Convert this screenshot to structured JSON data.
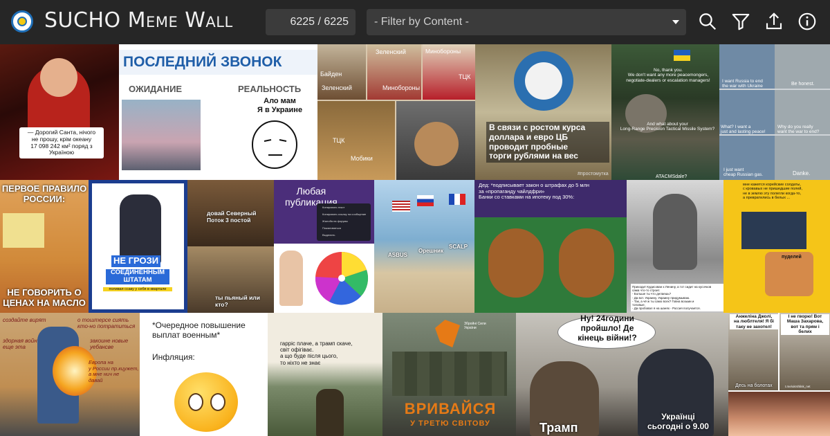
{
  "app": {
    "title_first": "SUCHO",
    "title_rest": "Meme Wall",
    "counter": "6225 / 6225",
    "filter_placeholder": "- Filter by Content -"
  },
  "toolbar": {
    "icons": [
      "search-icon",
      "filter-icon",
      "upload-icon",
      "info-icon"
    ]
  },
  "memes": {
    "santa": "— Дорогий Санта, нічого\nне прошу, крім океану\n17 098 242 км² поряд з\nУкраїною",
    "zvonok_title": "ПОСЛЕДНИЙ ЗВОНОК",
    "zvonok_left": "ОЖИДАНИЕ",
    "zvonok_right": "РЕАЛЬНОСТЬ",
    "zvonok_quote": "Ало мам\nЯ в Украине",
    "p1_a": "Байден",
    "p1_b": "Зеленский",
    "p1_c": "Минобороны",
    "p1_d": "Зеленский",
    "p1_e": "Минобороны",
    "p1_f": "ТЦК",
    "p1_g": "ТЦК",
    "p1_h": "Мобики",
    "scale": "В связи с ростом курса\nдоллара и евро ЦБ\nпроводит пробные\nторги рублями на вес",
    "scale_tag": "#простомутка",
    "gandalf_1": "No, thank you.\nWe don't want any more peacemongers,\nnegotiate-dealers or escalation managers!",
    "gandalf_2": "And what about your\nLong-Range Precision Tactical Missile System?",
    "gandalf_3": "ATACMSdale?",
    "scholz_1": "I want Russia to end\nthe war with Ukraine",
    "scholz_2": "Be honest.",
    "scholz_3": "What? I want a\njust and lasting peace!",
    "scholz_4": "Why do you really\nwant the war to end?",
    "scholz_5": "I just want\ncheap Russian gas.",
    "scholz_6": "Danke.",
    "fightclub_top": "ПЕРВОЕ ПРАВИЛО\nРОССИИ:",
    "fightclub_bottom": "НЕ ГОВОРИТЬ О\nЦЕНАХ НА МАСЛО",
    "medvedev_1": "НЕ ГРОЗИ",
    "medvedev_2": "СОЕДИНЕННЫМ\nШТАТАМ",
    "medvedev_3": "поливая ссаку у себя в квартале",
    "phone_1": "довай Северный\nПоток 3 постой",
    "phone_2": "ты пьяный или\nкто?",
    "wheel_title": "Любая\nпубликация",
    "menu_1": "Копировать текст",
    "menu_2": "Копировать ссылку на сообщение",
    "menu_3": "Жалоба на форумы",
    "menu_4": "Пожаловаться",
    "menu_5": "Выделить",
    "beach_1": "ASBUS",
    "beach_2": "Орешник",
    "beach_3": "SCALP",
    "monkey_head": "Дед: *подписывает закон о штрафах до 5 млн\nза «пропаганду чайлдфри»\nБанки со ставками на ипотеку под 30%:",
    "wheelchair_cap": "Приходит Кудисован к Ленину, а тот сидит на кусочков\nсама что-то строит.\n- Больше ты что делаешь?\n- Да вот. Украину, Украину придумываю.\n- Так, а чё ж ты само всех? Говна возьми и\nтоповые.\n- Да пробовал я на шанях - Россия получается.",
    "korean": "мне кажется корейские солдаты,\nс кровавых не пришедшие полей,\nне в землю эту полегли когда-то,\nа превратились в белых ...",
    "korean_2": "пуделей",
    "fire_l1": "создайте вирят",
    "fire_l2": "здорная войн\nеще эта",
    "fire_r1": "о тоштерсе сиять\nкто-но потратиться",
    "fire_r2": "закоине новые\nуебансве",
    "fire_r3": "Европа на\nу России пр.кцужет,\nа мне нич не\nдавай",
    "salary_1": "*Очередное повышение\nвыплат военным*",
    "salary_2": "Инфляция:",
    "harris": "гарріс плаче, а трамп скаче,\nсвіт офігіває.\nа що буде після цього,\nто ніхто не знає",
    "vryv_1": "ВРИВАЙСЯ",
    "vryv_2": "У ТРЕТЮ СВІТОВУ",
    "vryv_tag": "Збройні Сили\nУкраїни",
    "war_bubble": "Ну! 24години\nпройшло! Де\nкінець війни!?",
    "war_name": "Трамп",
    "war_sub": "Українці\nсьогодні о 9.00",
    "jolie_1": "Анжеліна Джолі,\nна люблтеля! Я бі\nтаку не захотел!",
    "jolie_2": "І не гворю! Вот\nМаша Захарова,\nвот та прям і\nбелих",
    "jolie_3": "Десь на болотах",
    "jolie_tag": "t.me/ukrshlink_net"
  },
  "colors": {
    "header_bg": "#262626",
    "control_bg": "#3b3b3b",
    "page_bg": "#1b1b1b",
    "zvonok_blue": "#1f5ea8",
    "fightclub_red": "#d82a2a",
    "medvedev_blue": "#1b3d8f",
    "monkey_purple": "#3e2a6b",
    "scale_blue": "#2b6fb0",
    "korean_yellow": "#f5c518",
    "vryv_orange": "#e67a16",
    "salary_emoji": "#f9b21c"
  }
}
